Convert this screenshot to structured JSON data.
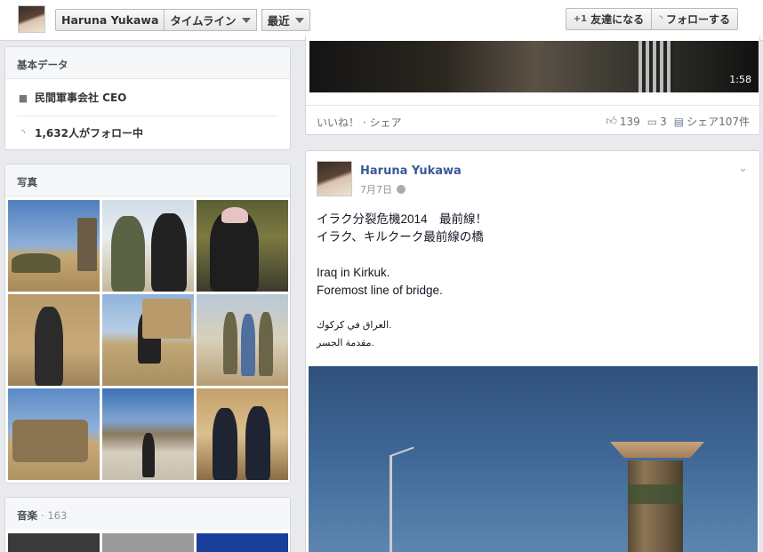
{
  "topbar": {
    "crumbs": [
      "Haruna Yukawa",
      "タイムライン",
      "最近"
    ],
    "actions": [
      {
        "icon": "add-friend-icon",
        "label": "友達になる"
      },
      {
        "icon": "rss-icon",
        "label": "フォローする"
      }
    ]
  },
  "basic_info": {
    "title": "基本データ",
    "rows": [
      {
        "icon": "briefcase-icon",
        "label": "民間軍事会社 CEO"
      },
      {
        "icon": "rss-icon",
        "label": "1,632人がフォロー中"
      }
    ]
  },
  "photos": {
    "title": "写真"
  },
  "music": {
    "title": "音楽",
    "count": "· 163"
  },
  "prev_post": {
    "video_duration": "1:58",
    "actions": "いいね！ · シェア",
    "likes": "139",
    "comments": "3",
    "shares": "シェア107件"
  },
  "post": {
    "author": "Haruna Yukawa",
    "date": "7月7日",
    "lines": [
      "イラク分裂危機2014　最前線！",
      "イラク、キルクーク最前線の橋",
      "",
      "Iraq in Kirkuk.",
      "Foremost line of bridge.",
      ""
    ],
    "arabic": [
      ".العراق في كركوك",
      ".مقدمة الجسر"
    ]
  },
  "colors": {
    "link": "#3b5998",
    "page_bg": "#e9eaed"
  }
}
